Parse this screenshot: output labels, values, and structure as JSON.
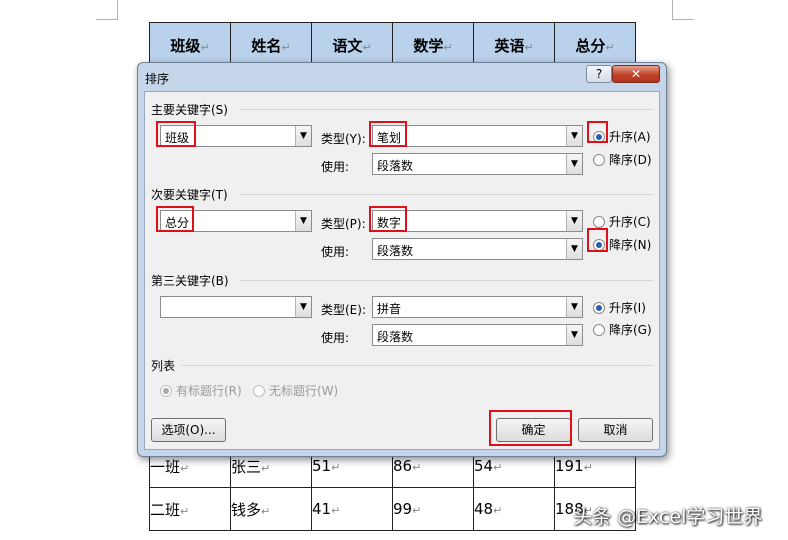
{
  "document": {
    "headers": [
      "班级",
      "姓名",
      "语文",
      "数学",
      "英语",
      "总分"
    ],
    "rows": [
      {
        "class": "一班",
        "name": "张三",
        "chinese": "51",
        "math": "86",
        "english": "54",
        "total": "191"
      },
      {
        "class": "二班",
        "name": "钱多",
        "chinese": "41",
        "math": "99",
        "english": "48",
        "total": "188"
      }
    ],
    "para_mark": "↵"
  },
  "dialog": {
    "title": "排序",
    "help": "?",
    "close": "✕",
    "primary_key": {
      "label": "主要关键字(S)",
      "column": "班级",
      "type_label": "类型(Y):",
      "type": "笔划",
      "use_label": "使用:",
      "use": "段落数",
      "asc": "升序(A)",
      "desc": "降序(D)",
      "order": "asc"
    },
    "secondary_key": {
      "label": "次要关键字(T)",
      "column": "总分",
      "type_label": "类型(P):",
      "type": "数字",
      "use_label": "使用:",
      "use": "段落数",
      "asc": "升序(C)",
      "desc": "降序(N)",
      "order": "desc"
    },
    "tertiary_key": {
      "label": "第三关键字(B)",
      "column": "",
      "type_label": "类型(E):",
      "type": "拼音",
      "use_label": "使用:",
      "use": "段落数",
      "asc": "升序(I)",
      "desc": "降序(G)",
      "order": "asc"
    },
    "list": {
      "label": "列表",
      "has_header": "有标题行(R)",
      "no_header": "无标题行(W)",
      "selected": "has_header"
    },
    "options_button": "选项(O)...",
    "ok_button": "确定",
    "cancel_button": "取消"
  },
  "watermark": "头条 @Excel学习世界",
  "colors": {
    "highlight": "#e0101a",
    "header_fill": "#b9d1ea",
    "dialog_frame": "#c5d6ea",
    "radio_selected": "#2a5db0"
  }
}
